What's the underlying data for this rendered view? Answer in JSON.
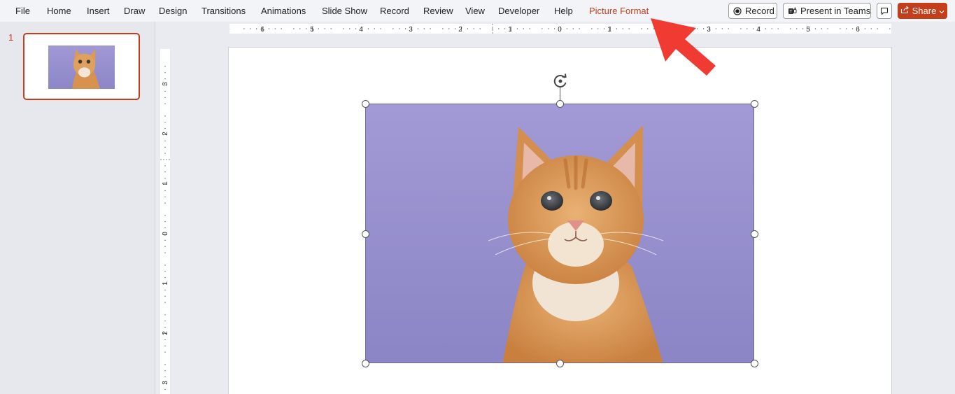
{
  "menu": {
    "tabs": [
      "File",
      "Home",
      "Insert",
      "Draw",
      "Design",
      "Transitions",
      "Animations",
      "Slide Show",
      "Record",
      "Review",
      "View",
      "Developer",
      "Help",
      "Picture Format"
    ],
    "active_tab": "Picture Format"
  },
  "toolbar": {
    "record_label": "Record",
    "present_label": "Present in Teams",
    "share_label": "Share"
  },
  "slides_panel": {
    "slide_number": "1"
  },
  "rulers": {
    "horizontal": [
      "6",
      "5",
      "4",
      "3",
      "2",
      "1",
      "0",
      "1",
      "2",
      "3",
      "4",
      "5",
      "6"
    ],
    "vertical": [
      "3",
      "2",
      "1",
      "0",
      "1",
      "2",
      "3"
    ]
  },
  "colors": {
    "accent": "#c43e1c",
    "picture_bg": "#9a93cf",
    "callout_arrow": "#f03b33"
  },
  "icons": {
    "record": "record-dot-icon",
    "present": "teams-icon",
    "share": "share-icon",
    "comments": "comment-icon",
    "rotate": "rotate-handle-icon"
  }
}
